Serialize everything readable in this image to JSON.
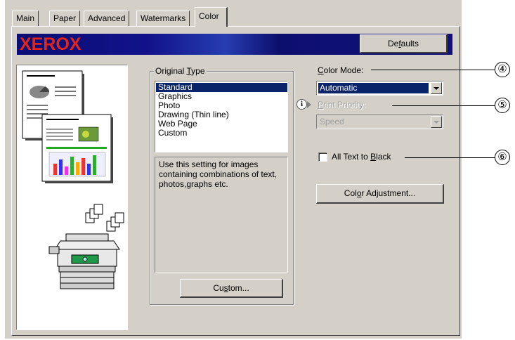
{
  "tabs": [
    "Main",
    "Paper",
    "Advanced",
    "Watermarks",
    "Color"
  ],
  "active_tab": "Color",
  "banner": {
    "logo_text": "XEROX"
  },
  "defaults_button": {
    "pre": "De",
    "accel": "f",
    "post": "aults"
  },
  "original_type": {
    "label_pre": "Original ",
    "label_accel": "T",
    "label_post": "ype",
    "items": [
      "Standard",
      "Graphics",
      "Photo",
      "Drawing (Thin line)",
      "Web Page",
      "Custom"
    ],
    "selected": "Standard",
    "description": "Use this setting for images containing combinations of text, photos,graphs etc.",
    "custom_button": {
      "pre": "Cu",
      "accel": "s",
      "post": "tom..."
    }
  },
  "color_mode": {
    "label_accel": "C",
    "label_rest": "olor Mode:",
    "value": "Automatic"
  },
  "print_priority": {
    "label_accel": "P",
    "label_rest": "rint Priority:",
    "value": "Speed",
    "info_icon_glyph": "i"
  },
  "all_text_black": {
    "label_pre": "All Text to ",
    "label_accel": "B",
    "label_post": "lack",
    "checked": false
  },
  "color_adjustment_button": {
    "pre": "Col",
    "accel": "o",
    "post": "r Adjustment..."
  },
  "preview": {
    "doc_title": "The Effect of Interface Forms",
    "doc_subtitle": "Communication Effects"
  },
  "callouts": [
    "④",
    "⑤",
    "⑥"
  ],
  "colors": {
    "selection": "#0a246a",
    "face": "#d4d0c8",
    "logo_red": "#e0261c",
    "banner_blue": "#10117c"
  }
}
